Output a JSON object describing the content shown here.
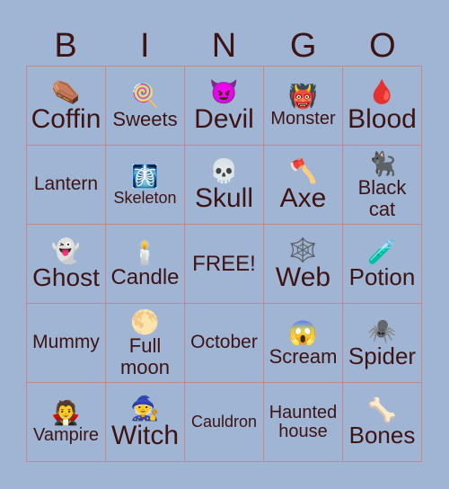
{
  "header": [
    "B",
    "I",
    "N",
    "G",
    "O"
  ],
  "cells": [
    {
      "label": "Coffin",
      "icon": "⚰️",
      "size": 30
    },
    {
      "label": "Sweets",
      "icon": "🍭",
      "size": 22
    },
    {
      "label": "Devil",
      "icon": "😈",
      "size": 30
    },
    {
      "label": "Monster",
      "icon": "👹",
      "size": 20
    },
    {
      "label": "Blood",
      "icon": "🩸",
      "size": 30
    },
    {
      "label": "Lantern",
      "icon": "",
      "size": 21
    },
    {
      "label": "Skeleton",
      "icon": "🩻",
      "size": 18
    },
    {
      "label": "Skull",
      "icon": "💀",
      "size": 30
    },
    {
      "label": "Axe",
      "icon": "🪓",
      "size": 30
    },
    {
      "label": "Black cat",
      "icon": "🐈‍⬛",
      "size": 22
    },
    {
      "label": "Ghost",
      "icon": "👻",
      "size": 28
    },
    {
      "label": "Candle",
      "icon": "🕯️",
      "size": 24
    },
    {
      "label": "FREE!",
      "icon": "",
      "size": 24
    },
    {
      "label": "Web",
      "icon": "🕸️",
      "size": 30
    },
    {
      "label": "Potion",
      "icon": "🧪",
      "size": 26
    },
    {
      "label": "Mummy",
      "icon": "",
      "size": 21
    },
    {
      "label": "Full moon",
      "icon": "🌕",
      "size": 22
    },
    {
      "label": "October",
      "icon": "",
      "size": 21
    },
    {
      "label": "Scream",
      "icon": "😱",
      "size": 22
    },
    {
      "label": "Spider",
      "icon": "🕷️",
      "size": 26
    },
    {
      "label": "Vampire",
      "icon": "🧛",
      "size": 20
    },
    {
      "label": "Witch",
      "icon": "🧙",
      "size": 30
    },
    {
      "label": "Cauldron",
      "icon": "",
      "size": 18
    },
    {
      "label": "Haunted house",
      "icon": "",
      "size": 20
    },
    {
      "label": "Bones",
      "icon": "🦴",
      "size": 26
    }
  ]
}
